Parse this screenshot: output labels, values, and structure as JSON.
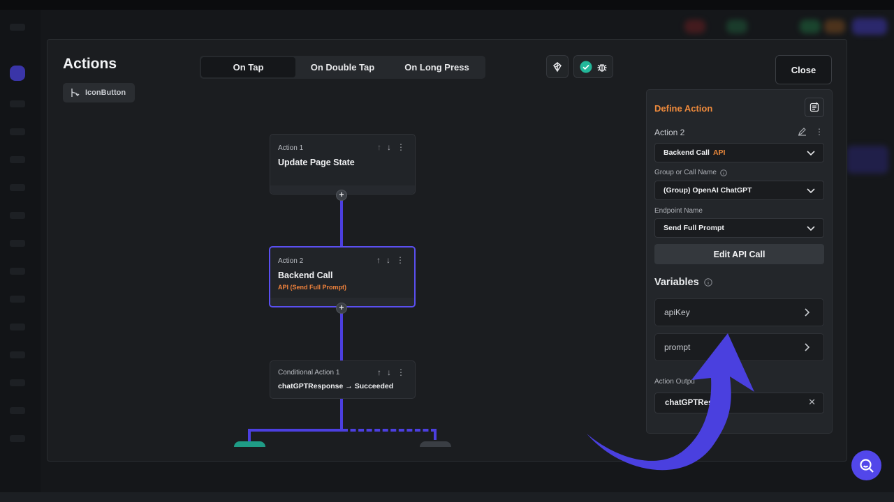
{
  "dialog": {
    "title": "Actions",
    "widget_chip": "IconButton",
    "tabs": [
      {
        "label": "On Tap",
        "active": true
      },
      {
        "label": "On Double Tap",
        "active": false
      },
      {
        "label": "On Long Press",
        "active": false
      }
    ],
    "close_label": "Close"
  },
  "flow": {
    "nodes": [
      {
        "label": "Action 1",
        "name": "Update Page State",
        "sub": ""
      },
      {
        "label": "Action 2",
        "name": "Backend Call",
        "sub": "API (Send Full Prompt)"
      },
      {
        "label": "Conditional Action 1",
        "name": "chatGPTResponse → Succeeded",
        "sub": ""
      }
    ]
  },
  "panel": {
    "title": "Define Action",
    "action_label": "Action 2",
    "action_type": "Backend Call",
    "action_type_tag": "API",
    "group_label": "Group or Call Name",
    "group_value": "(Group) OpenAI ChatGPT",
    "endpoint_label": "Endpoint Name",
    "endpoint_value": "Send Full Prompt",
    "edit_button": "Edit API Call",
    "variables_title": "Variables",
    "variables": [
      "apiKey",
      "prompt"
    ],
    "output_label": "Action Outpu",
    "output_value": "chatGPTRespo"
  },
  "colors": {
    "accent": "#5247ea",
    "orange": "#ee8a3c",
    "connector": "#4c3fe0",
    "success": "#23b89a"
  },
  "icons": [
    "branch-icon",
    "debug-icon",
    "check-circle-icon",
    "bug-icon",
    "doc-icon",
    "edit-icon",
    "more-icon",
    "search-icon"
  ]
}
